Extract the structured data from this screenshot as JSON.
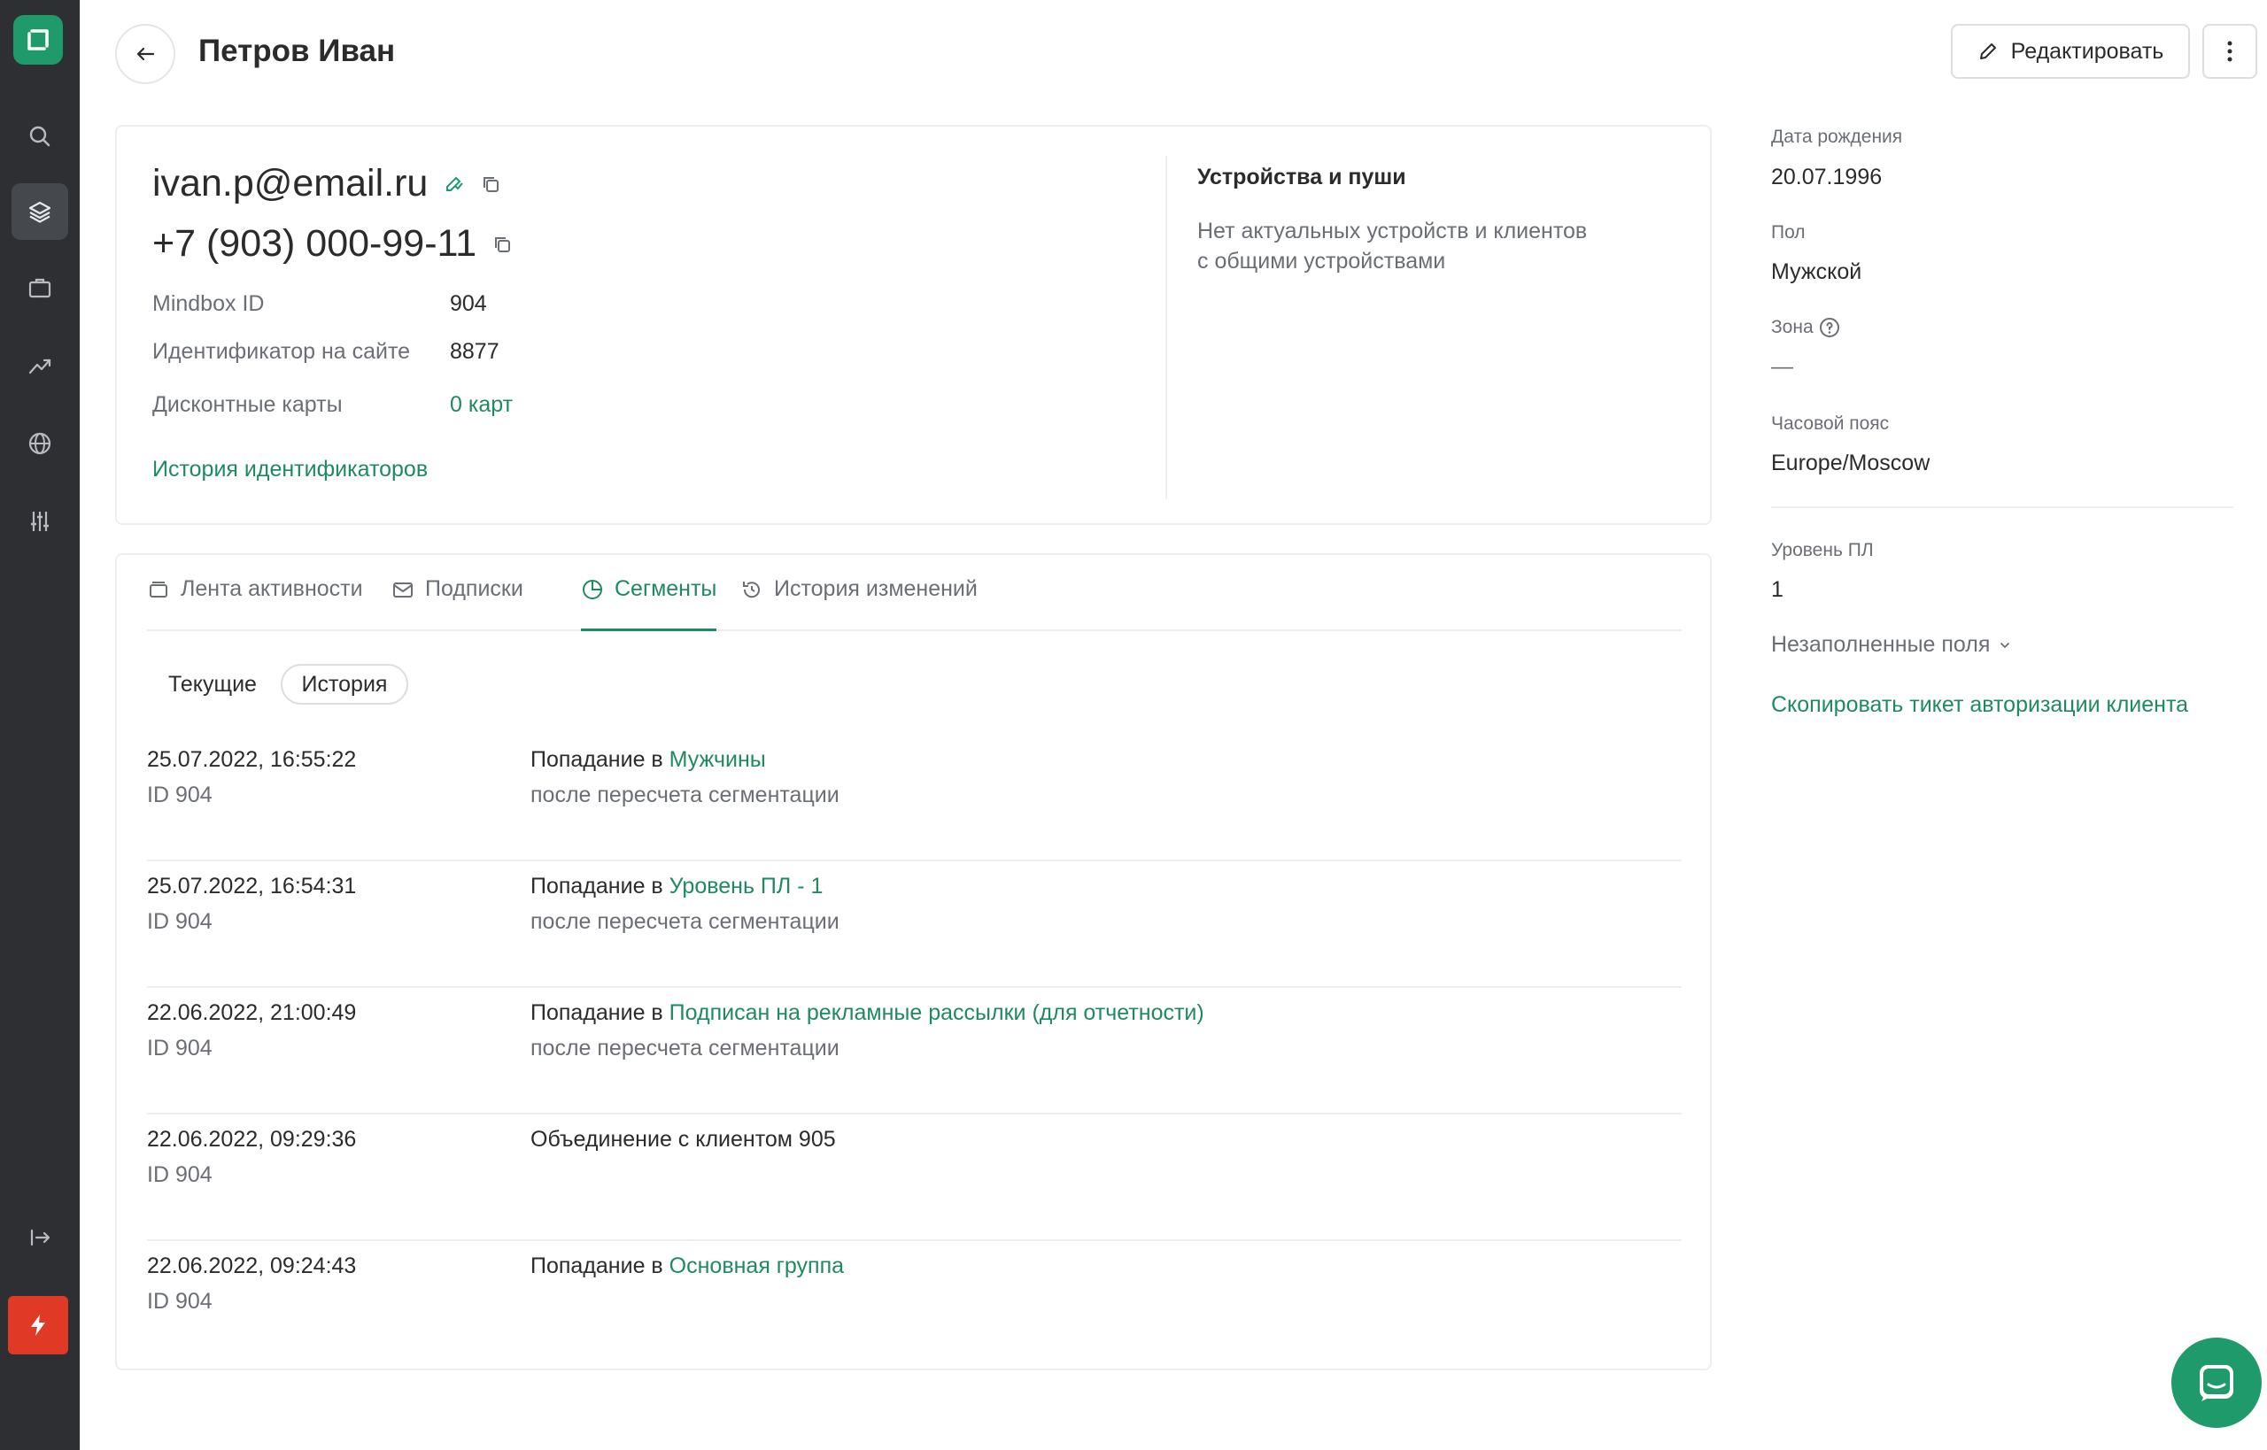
{
  "header": {
    "title": "Петров Иван",
    "edit_label": "Редактировать"
  },
  "contact": {
    "email": "ivan.p@email.ru",
    "phone": "+7 (903) 000-99-11",
    "fields": [
      {
        "label": "Mindbox ID",
        "value": "904"
      },
      {
        "label": "Идентификатор на сайте",
        "value": "8877"
      },
      {
        "label": "Дисконтные карты",
        "value": "0 карт"
      }
    ],
    "history_link": "История идентификаторов"
  },
  "devices": {
    "title": "Устройства и пуши",
    "text_line1": "Нет актуальных устройств и клиентов",
    "text_line2": "с общими устройствами"
  },
  "tabs": [
    {
      "label": "Лента активности",
      "icon": "feed-icon"
    },
    {
      "label": "Подписки",
      "icon": "mail-icon"
    },
    {
      "label": "Сегменты",
      "icon": "pie-chart-icon",
      "active": true
    },
    {
      "label": "История изменений",
      "icon": "history-icon"
    }
  ],
  "subtabs": {
    "current": "Текущие",
    "history": "История",
    "selected": "История"
  },
  "events": [
    {
      "date": "25.07.2022, 16:55:22",
      "id": "ID 904",
      "prefix": "Попадание в",
      "segment": "Мужчины",
      "sub": "после пересчета сегментации"
    },
    {
      "date": "25.07.2022, 16:54:31",
      "id": "ID 904",
      "prefix": "Попадание в",
      "segment": "Уровень ПЛ - 1",
      "sub": "после пересчета сегментации"
    },
    {
      "date": "22.06.2022, 21:00:49",
      "id": "ID 904",
      "prefix": "Попадание в",
      "segment": "Подписан на рекламные рассылки (для отчетности)",
      "sub": "после пересчета сегментации"
    },
    {
      "date": "22.06.2022, 09:29:36",
      "id": "ID 904",
      "prefix": "Объединение с клиентом 905",
      "segment": "",
      "sub": ""
    },
    {
      "date": "22.06.2022, 09:24:43",
      "id": "ID 904",
      "prefix": "Попадание в",
      "segment": "Основная группа",
      "sub": ""
    }
  ],
  "profile": {
    "birth_label": "Дата рождения",
    "birth_value": "20.07.1996",
    "gender_label": "Пол",
    "gender_value": "Мужской",
    "zone_label": "Зона",
    "zone_value": "—",
    "tz_label": "Часовой пояс",
    "tz_value": "Europe/Moscow",
    "pl_label": "Уровень ПЛ",
    "pl_value": "1",
    "empty_fields": "Незаполненные поля",
    "copy_ticket": "Скопировать тикет авторизации клиента"
  },
  "colors": {
    "accent": "#1f8a5f",
    "sidebar": "#2d2f33",
    "danger": "#e03a26"
  }
}
